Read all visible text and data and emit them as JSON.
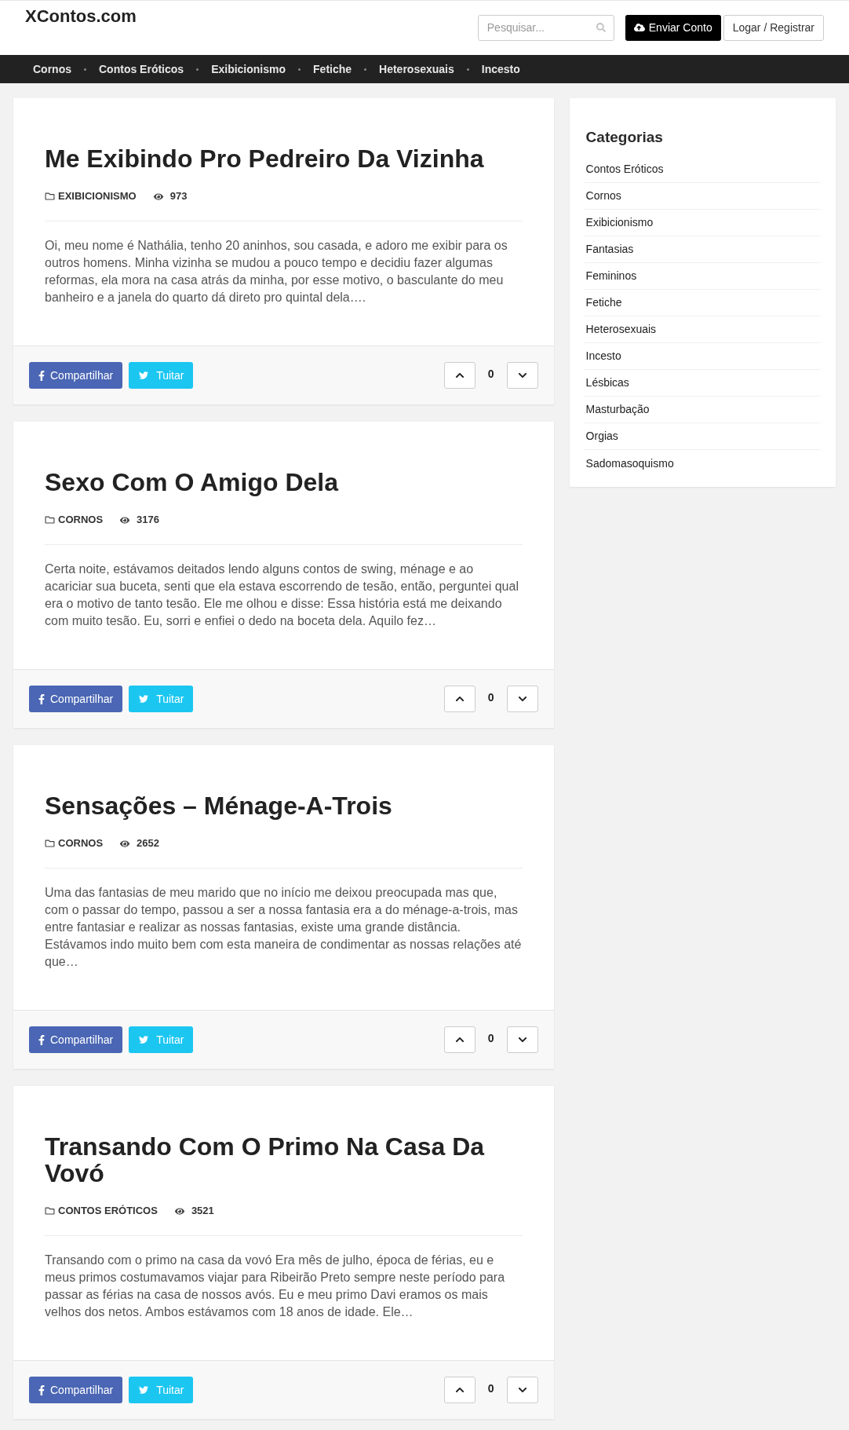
{
  "header": {
    "logo": "XContos.com",
    "search": {
      "placeholder": "Pesquisar..."
    },
    "buttons": [
      {
        "kind": "primary",
        "label": "Enviar Conto"
      },
      {
        "kind": "outline",
        "label": "Logar / Registrar"
      }
    ]
  },
  "nav": {
    "items": [
      "Cornos",
      "Contos Eróticos",
      "Exibicionismo",
      "Fetiche",
      "Heterosexuais",
      "Incesto"
    ]
  },
  "posts": [
    {
      "title": "Me Exibindo Pro Pedreiro Da Vizinha",
      "category": "EXIBICIONISMO",
      "views": "973",
      "excerpt": "Oi, meu nome é Nathália, tenho 20 aninhos, sou casada, e adoro me exibir para os outros homens. Minha vizinha se mudou a pouco tempo e decidiu fazer algumas reformas, ela mora na casa atrás da minha, por esse motivo, o basculante do meu banheiro e a janela do quarto dá direto pro quintal dela….",
      "share_buttons": [
        {
          "kind": "facebook",
          "label": "Compartilhar"
        },
        {
          "kind": "twitter",
          "label": "Tuitar"
        }
      ],
      "votes": "0"
    },
    {
      "title": "Sexo Com O Amigo Dela",
      "category": "CORNOS",
      "views": "3176",
      "excerpt": "Certa noite, estávamos deitados lendo alguns contos de swing, ménage e ao acariciar sua buceta, senti que ela estava escorrendo de tesão, então, perguntei qual era o motivo de tanto tesão. Ele me olhou e disse: Essa história está me deixando com muito tesão. Eu, sorri e enfiei o dedo na boceta dela. Aquilo fez…",
      "share_buttons": [
        {
          "kind": "facebook",
          "label": "Compartilhar"
        },
        {
          "kind": "twitter",
          "label": "Tuitar"
        }
      ],
      "votes": "0"
    },
    {
      "title": "Sensações – Ménage-A-Trois",
      "category": "CORNOS",
      "views": "2652",
      "excerpt": "Uma das fantasias de meu marido que no início me deixou preocupada mas que, com o passar do tempo, passou a ser a nossa fantasia era a do ménage-a-trois, mas entre fantasiar e realizar as nossas fantasias, existe uma grande distância. Estávamos indo muito bem com esta maneira de condimentar as nossas relações até que…",
      "share_buttons": [
        {
          "kind": "facebook",
          "label": "Compartilhar"
        },
        {
          "kind": "twitter",
          "label": "Tuitar"
        }
      ],
      "votes": "0"
    },
    {
      "title": "Transando Com O Primo Na Casa Da Vovó",
      "category": "CONTOS ERÓTICOS",
      "views": "3521",
      "excerpt": "Transando com o primo na casa da vovó Era mês de julho, época de férias, eu e meus primos costumavamos viajar para Ribeirão Preto sempre neste período para passar as férias na casa de nossos avós. Eu e meu primo Davi eramos os mais velhos dos netos. Ambos estávamos com 18 anos de idade. Ele…",
      "share_buttons": [
        {
          "kind": "facebook",
          "label": "Compartilhar"
        },
        {
          "kind": "twitter",
          "label": "Tuitar"
        }
      ],
      "votes": "0"
    }
  ],
  "sidebar": {
    "title": "Categorias",
    "items": [
      "Contos Eróticos",
      "Cornos",
      "Exibicionismo",
      "Fantasias",
      "Femininos",
      "Fetiche",
      "Heterosexuais",
      "Incesto",
      "Lésbicas",
      "Masturbação",
      "Orgias",
      "Sadomasoquismo"
    ]
  }
}
